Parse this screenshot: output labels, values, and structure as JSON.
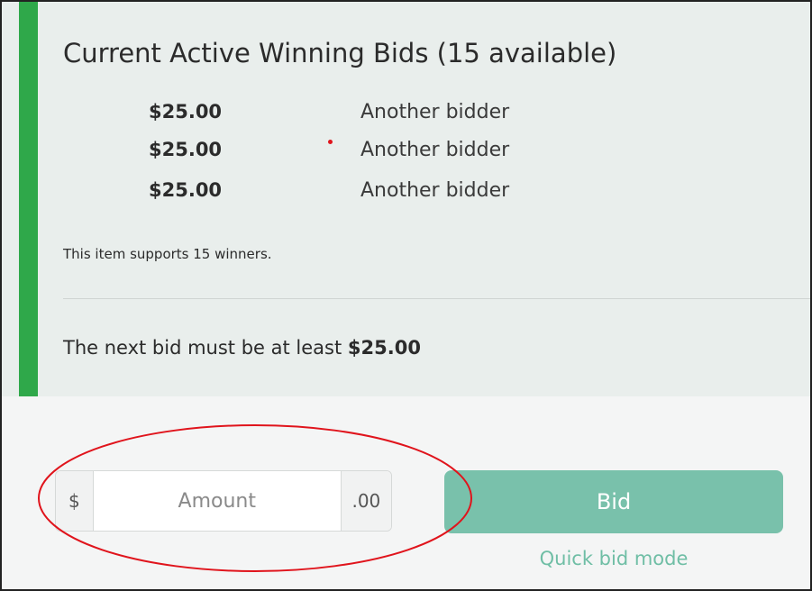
{
  "bids_panel": {
    "title": "Current Active Winning Bids (15 available)",
    "bids": [
      {
        "amount": "$25.00",
        "bidder": "Another bidder"
      },
      {
        "amount": "$25.00",
        "bidder": "Another bidder"
      },
      {
        "amount": "$25.00",
        "bidder": "Another bidder"
      }
    ],
    "winners_note": "This item supports 15 winners.",
    "next_bid_prefix": "The next bid must be at least",
    "next_bid_amount": "$25.00"
  },
  "bid_form": {
    "currency_symbol": "$",
    "amount_placeholder": "Amount",
    "amount_value": "",
    "cents_suffix": ".00",
    "bid_button_label": "Bid",
    "quick_bid_link": "Quick bid mode"
  },
  "colors": {
    "accent_bar": "#2fa84a",
    "bid_button": "#79c1ab",
    "quick_bid_link": "#6fbea5",
    "annotation": "#e0141c"
  }
}
